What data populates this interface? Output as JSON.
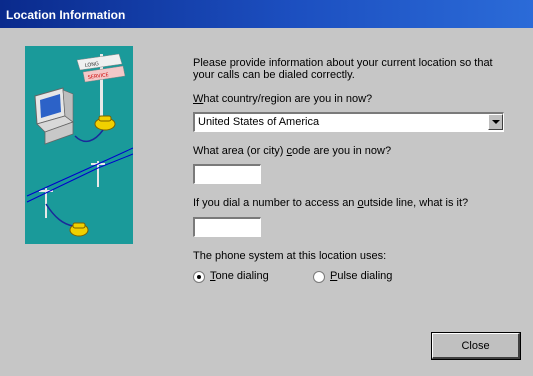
{
  "window": {
    "title": "Location Information"
  },
  "intro": {
    "line1": "Please provide information about your current location so that",
    "line2": "your calls can be dialed correctly."
  },
  "country": {
    "label_underlined": "W",
    "label_rest": "hat country/region are you in now?",
    "value": "United States of America"
  },
  "area_code": {
    "label_pre": "What area (or city) ",
    "label_underlined": "c",
    "label_post": "ode are you in now?",
    "value": ""
  },
  "outside_line": {
    "label_pre": "If you dial a number to access an ",
    "label_underlined": "o",
    "label_post": "utside line, what is it?",
    "value": ""
  },
  "phone_system": {
    "label": "The phone system at this location uses:",
    "tone": {
      "underlined": "T",
      "rest": "one dialing",
      "selected": true
    },
    "pulse": {
      "underlined": "P",
      "rest": "ulse dialing",
      "selected": false
    }
  },
  "buttons": {
    "close": "Close"
  },
  "illustration": {
    "sign_top": "LONG",
    "sign_bottom": "SERVICE",
    "background_color": "#1a9a9a"
  }
}
